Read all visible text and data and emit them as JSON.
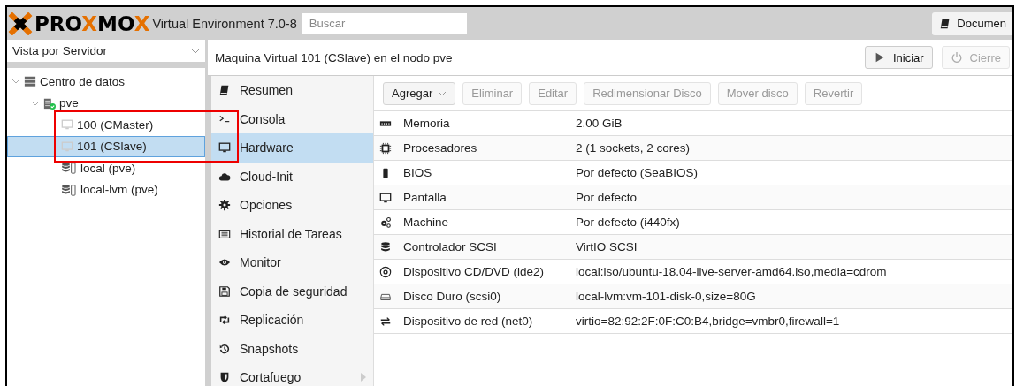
{
  "header": {
    "logo_parts": [
      {
        "text": "PRO",
        "accent": false
      },
      {
        "text": "X",
        "accent": true
      },
      {
        "text": "MO",
        "accent": false
      },
      {
        "text": "X",
        "accent": true
      }
    ],
    "product": "Virtual Environment 7.0-8",
    "search": {
      "placeholder": "Buscar"
    },
    "docs_button": "Documen"
  },
  "sidebar": {
    "view_selector": "Vista por Servidor",
    "tree": [
      {
        "label": "Centro de datos",
        "kind": "datacenter",
        "expanded": true,
        "selected": false,
        "children": [
          {
            "label": "pve",
            "kind": "node",
            "expanded": true,
            "selected": false,
            "children": [
              {
                "label": "100 (CMaster)",
                "kind": "vm",
                "selected": false
              },
              {
                "label": "101 (CSlave)",
                "kind": "vm",
                "selected": true
              },
              {
                "label": "local (pve)",
                "kind": "storage",
                "selected": false
              },
              {
                "label": "local-lvm (pve)",
                "kind": "storage",
                "selected": false
              }
            ]
          }
        ]
      }
    ]
  },
  "content": {
    "title": "Maquina Virtual 101 (CSlave) en el nodo pve",
    "actions": [
      {
        "label": "Iniciar",
        "kind": "start",
        "disabled": false
      },
      {
        "label": "Cierre",
        "kind": "shutdown",
        "disabled": true
      }
    ],
    "nav": [
      {
        "label": "Resumen",
        "kind": "book",
        "selected": false
      },
      {
        "label": "Consola",
        "kind": "terminal",
        "selected": false
      },
      {
        "label": "Hardware",
        "kind": "monitor",
        "selected": true
      },
      {
        "label": "Cloud-Init",
        "kind": "cloud",
        "selected": false
      },
      {
        "label": "Opciones",
        "kind": "gear",
        "selected": false
      },
      {
        "label": "Historial de Tareas",
        "kind": "list",
        "selected": false
      },
      {
        "label": "Monitor",
        "kind": "eye",
        "selected": false
      },
      {
        "label": "Copia de seguridad",
        "kind": "floppy",
        "selected": false
      },
      {
        "label": "Replicación",
        "kind": "retweet",
        "selected": false
      },
      {
        "label": "Snapshots",
        "kind": "history",
        "selected": false
      },
      {
        "label": "Cortafuego",
        "kind": "shield",
        "selected": false,
        "has_submenu": true
      }
    ],
    "toolbar": [
      {
        "label": "Agregar",
        "disabled": false,
        "dropdown": true
      },
      {
        "label": "Eliminar",
        "disabled": true
      },
      {
        "label": "Editar",
        "disabled": true
      },
      {
        "label": "Redimensionar Disco",
        "disabled": true
      },
      {
        "label": "Mover disco",
        "disabled": true
      },
      {
        "label": "Revertir",
        "disabled": true
      }
    ],
    "table": {
      "rows": [
        {
          "kind": "memory",
          "name": "Memoria",
          "value": "2.00 GiB"
        },
        {
          "kind": "cpu",
          "name": "Procesadores",
          "value": "2 (1 sockets, 2 cores)"
        },
        {
          "kind": "chip",
          "name": "BIOS",
          "value": "Por defecto (SeaBIOS)"
        },
        {
          "kind": "monitor",
          "name": "Pantalla",
          "value": "Por defecto"
        },
        {
          "kind": "gears",
          "name": "Machine",
          "value": "Por defecto (i440fx)"
        },
        {
          "kind": "database",
          "name": "Controlador SCSI",
          "value": "VirtIO SCSI"
        },
        {
          "kind": "disc",
          "name": "Dispositivo CD/DVD (ide2)",
          "value": "local:iso/ubuntu-18.04-live-server-amd64.iso,media=cdrom"
        },
        {
          "kind": "hdd",
          "name": "Disco Duro (scsi0)",
          "value": "local-lvm:vm-101-disk-0,size=80G"
        },
        {
          "kind": "network",
          "name": "Dispositivo de red (net0)",
          "value": "virtio=82:92:2F:0F:C0:B4,bridge=vmbr0,firewall=1"
        }
      ]
    }
  }
}
